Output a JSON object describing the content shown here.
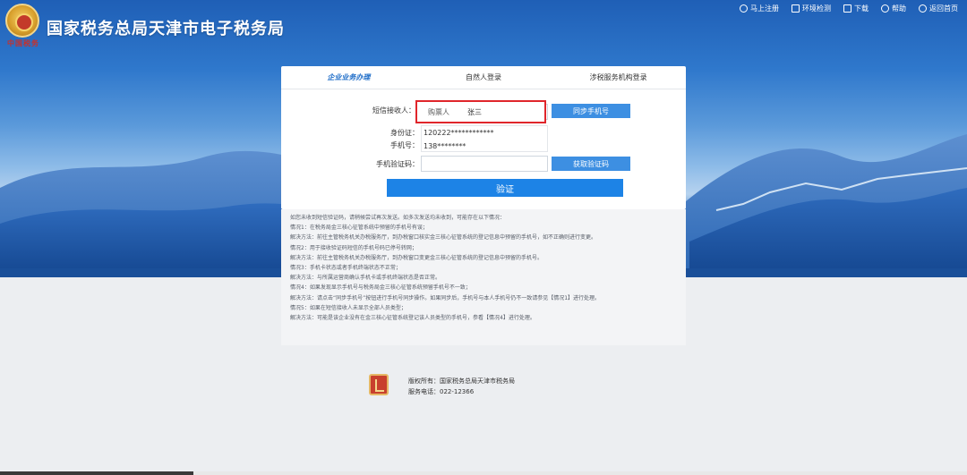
{
  "header": {
    "logo_script": "中国税务",
    "title": "国家税务总局天津市电子税务局",
    "links": [
      "马上注册",
      "环境检测",
      "下载",
      "帮助",
      "返回首页"
    ]
  },
  "tabs": [
    "企业业务办理",
    "自然人登录",
    "涉税服务机构登录"
  ],
  "form": {
    "receiver_label": "短信接收人：",
    "receiver_role": "购票人",
    "receiver_name": "张三",
    "sync_phone_button": "同步手机号",
    "id_label": "身份证：",
    "id_value": "120222************",
    "phone_label": "手机号：",
    "phone_value": "138********",
    "code_label": "手机验证码：",
    "code_value": "",
    "get_code_button": "获取验证码",
    "verify_button": "验证"
  },
  "notes": [
    "如您未收到短信验证码，请稍候尝试再次发送。如多次发送均未收到，可能存在以下情况：",
    "情况1：在税务局金三核心征管系统中预留的手机号有误；",
    "解决方法：前往主管税务机关办税服务厅，到办税窗口核实金三核心征管系统的登记信息中预留的手机号，如不正确则进行变更。",
    "情况2：用于接收验证码短信的手机号码已停号转网；",
    "解决方法：前往主管税务机关办税服务厅，到办税窗口变更金三核心征管系统的登记信息中预留的手机号。",
    "情况3：手机卡状态或者手机终端状态不正常；",
    "解决方法：与所属运营商确认手机卡或手机终端状态是否正常。",
    "情况4：如果发现显示手机号与税务局金三核心征管系统预留手机号不一致；",
    "解决方法：请点击“同步手机号”按钮进行手机号同步操作。如果同步后，手机号与本人手机号仍不一致请参见【情况1】进行处理。",
    "情况5：如果在短信接收人未显示全部人员类型；",
    "解决方法：可能是该企业没有在金三核心征管系统登记该人员类型的手机号，参看【情况4】进行处理。"
  ],
  "footer": {
    "copyright": "版权所有：国家税务总局天津市税务局",
    "service_phone": "服务电话：022-12366"
  },
  "colors": {
    "accent": "#1d83e6",
    "active_tab": "#1d6cc8",
    "highlight_border": "#e0252b"
  }
}
